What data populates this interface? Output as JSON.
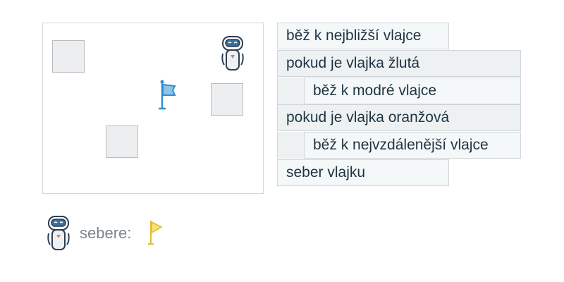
{
  "board": {
    "tiles": 3,
    "flag_color": "#2f8fd1",
    "robot_icon": "robot-icon"
  },
  "program": {
    "blocks": [
      {
        "type": "command",
        "indent": 0,
        "label": "běž k nejbližší vlajce"
      },
      {
        "type": "condition",
        "indent": 0,
        "label": "pokud je vlajka žlutá"
      },
      {
        "type": "command",
        "indent": 1,
        "label": "běž k modré vlajce"
      },
      {
        "type": "condition",
        "indent": 0,
        "label": "pokud je vlajka oranžová"
      },
      {
        "type": "command",
        "indent": 1,
        "label": "běž k nejvzdálenější vlajce"
      },
      {
        "type": "command",
        "indent": 0,
        "label": "seber vlajku"
      }
    ]
  },
  "result": {
    "label": "sebere:",
    "flag_color": "#f3d33b"
  }
}
